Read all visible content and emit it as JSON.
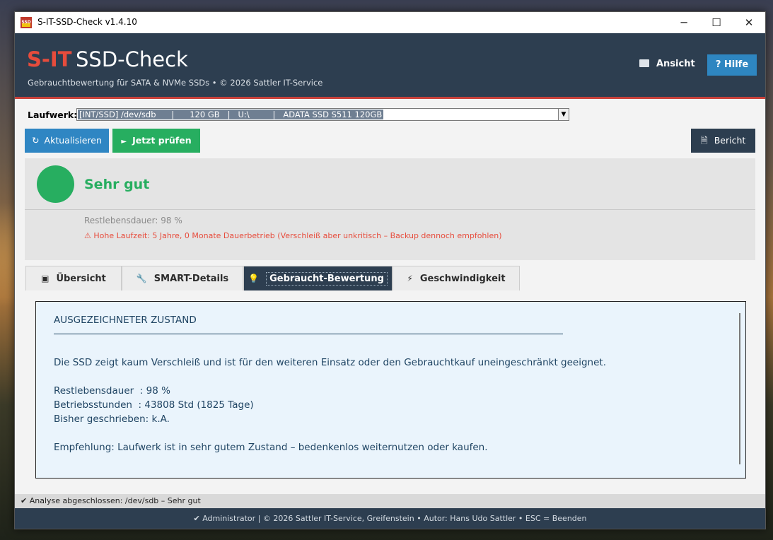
{
  "window": {
    "title": "S-IT-SSD-Check  v1.4.10",
    "icon_text": "SSD",
    "minimize": "─",
    "maximize": "☐",
    "close": "✕"
  },
  "header": {
    "brand_prefix": "S-IT",
    "brand_name": "SSD-Check",
    "tagline": "Gebrauchtbewertung für SATA & NVMe SSDs  •  © 2026 Sattler IT-Service",
    "view_label": "Ansicht",
    "help_label": "? Hilfe"
  },
  "drive": {
    "label": "Laufwerk:",
    "selected": "[INT/SSD] /dev/sdb      |      120 GB   |   U:\\         |   ADATA SSD S511 120GB"
  },
  "toolbar": {
    "refresh_label": "Aktualisieren",
    "refresh_icon": "↻",
    "check_label": "Jetzt prüfen",
    "check_icon": "►",
    "report_label": "Bericht",
    "report_icon": "🗎"
  },
  "status": {
    "rating": "Sehr gut",
    "remaining_life": "Restlebensdauer: 98 %",
    "warning": "⚠  Hohe Laufzeit: 5 Jahre, 0 Monate Dauerbetrieb (Verschleiß aber unkritisch – Backup dennoch empfohlen)",
    "color": "#27ae60"
  },
  "tabs": [
    {
      "label": "Übersicht",
      "icon": "▣"
    },
    {
      "label": "SMART-Details",
      "icon": "🔧"
    },
    {
      "label": "Gebraucht-Bewertung",
      "icon": "💡"
    },
    {
      "label": "Geschwindigkeit",
      "icon": "⚡"
    }
  ],
  "content": {
    "heading": "AUSGEZEICHNETER ZUSTAND",
    "summary": "Die SSD zeigt kaum Verschleiß und ist für den weiteren Einsatz oder den Gebrauchtkauf uneingeschränkt geeignet.",
    "line_life": "Restlebensdauer  : 98 %",
    "line_hours": "Betriebsstunden  : 43808 Std (1825 Tage)",
    "line_written": "Bisher geschrieben: k.A.",
    "recommendation": "Empfehlung: Laufwerk ist in sehr gutem Zustand – bedenkenlos weiternutzen oder kaufen."
  },
  "statusbar": {
    "text": "✔  Analyse abgeschlossen: /dev/sdb  –  Sehr gut"
  },
  "footer": {
    "text": "✔ Administrator  |  © 2026 Sattler IT-Service, Greifenstein  •  Autor: Hans Udo Sattler  •  ESC = Beenden"
  }
}
